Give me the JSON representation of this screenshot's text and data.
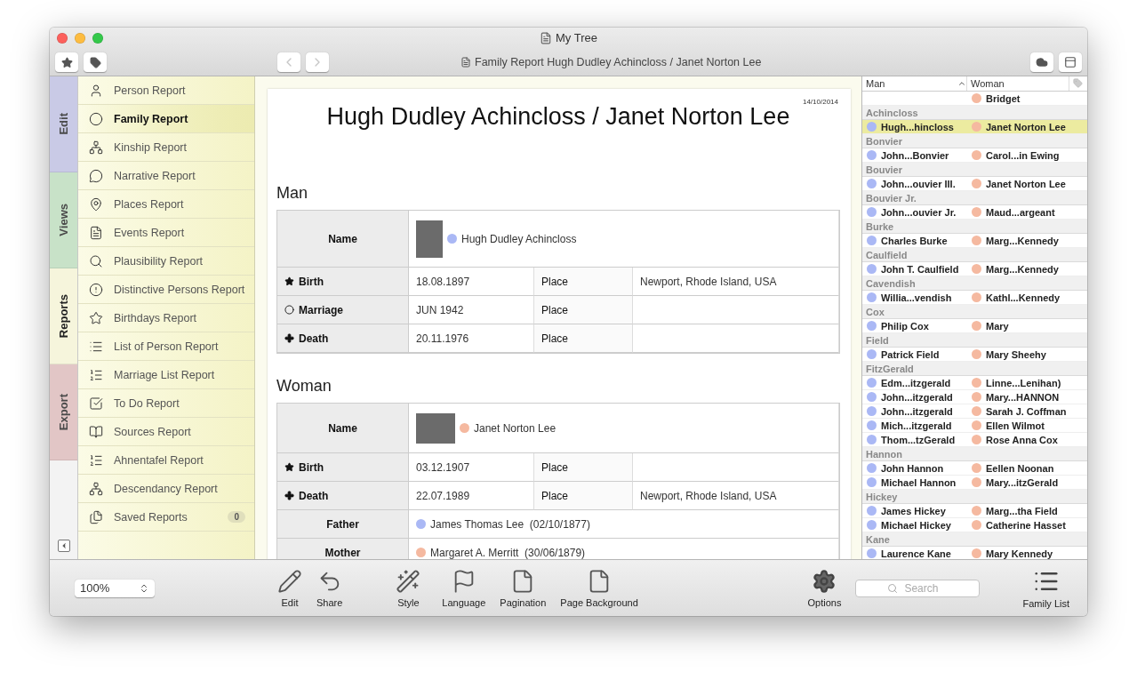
{
  "window": {
    "title": "My Tree"
  },
  "toolbar": {
    "document_title": "Family Report Hugh Dudley Achincloss / Janet Norton Lee"
  },
  "side_tabs": [
    {
      "label": "Edit",
      "selected": false,
      "color": "#c9cae6"
    },
    {
      "label": "Views",
      "selected": false,
      "color": "#c8e2c8"
    },
    {
      "label": "Reports",
      "selected": true,
      "color": "#f6f5dc"
    },
    {
      "label": "Export",
      "selected": false,
      "color": "#e2c6c6"
    }
  ],
  "reports": [
    {
      "label": "Person Report",
      "selected": false
    },
    {
      "label": "Family Report",
      "selected": true
    },
    {
      "label": "Kinship Report",
      "selected": false
    },
    {
      "label": "Narrative Report",
      "selected": false
    },
    {
      "label": "Places Report",
      "selected": false
    },
    {
      "label": "Events Report",
      "selected": false
    },
    {
      "label": "Plausibility Report",
      "selected": false
    },
    {
      "label": "Distinctive Persons Report",
      "selected": false
    },
    {
      "label": "Birthdays Report",
      "selected": false
    },
    {
      "label": "List of Person Report",
      "selected": false
    },
    {
      "label": "Marriage List Report",
      "selected": false
    },
    {
      "label": "To Do Report",
      "selected": false
    },
    {
      "label": "Sources Report",
      "selected": false
    },
    {
      "label": "Ahnentafel Report",
      "selected": false
    },
    {
      "label": "Descendancy Report",
      "selected": false
    },
    {
      "label": "Saved Reports",
      "selected": false,
      "count": "0"
    }
  ],
  "document": {
    "date": "14/10/2014",
    "title": "Hugh Dudley Achincloss / Janet Norton Lee",
    "sections": [
      {
        "heading": "Man",
        "rows": [
          {
            "kind": "name",
            "label": "Name",
            "person": "Hugh Dudley Achincloss",
            "color": "#aab8f5"
          },
          {
            "kind": "birth",
            "label": "Birth",
            "date": "18.08.1897",
            "place_label": "Place",
            "place": "Newport, Rhode Island, USA"
          },
          {
            "kind": "marriage",
            "label": "Marriage",
            "date": "JUN 1942",
            "place_label": "Place"
          },
          {
            "kind": "death",
            "label": "Death",
            "date": "20.11.1976",
            "place_label": "Place"
          }
        ]
      },
      {
        "heading": "Woman",
        "rows": [
          {
            "kind": "name",
            "label": "Name",
            "person": "Janet Norton Lee",
            "color": "#f5b9a0"
          },
          {
            "kind": "birth",
            "label": "Birth",
            "date": "03.12.1907",
            "place_label": "Place"
          },
          {
            "kind": "death",
            "label": "Death",
            "date": "22.07.1989",
            "place_label": "Place",
            "place": "Newport, Rhode Island, USA"
          },
          {
            "kind": "parent",
            "label": "Father",
            "person": "James Thomas Lee",
            "date": "(02/10/1877)",
            "color": "#aab8f5"
          },
          {
            "kind": "parent",
            "label": "Mother",
            "person": "Margaret A. Merritt",
            "date": "(30/06/1879)",
            "color": "#f5b9a0"
          }
        ]
      }
    ]
  },
  "family_list": {
    "columns": [
      "Man",
      "Woman"
    ],
    "rows": [
      {
        "kind": "couple",
        "woman": "Bridget",
        "selected": false
      },
      {
        "kind": "header",
        "surname": "Achincloss"
      },
      {
        "kind": "couple",
        "man": "Hugh...hincloss",
        "woman": "Janet Norton Lee",
        "selected": true
      },
      {
        "kind": "header",
        "surname": "Bonvier"
      },
      {
        "kind": "couple",
        "man": "John...Bonvier",
        "woman": "Carol...in Ewing",
        "selected": false
      },
      {
        "kind": "header",
        "surname": "Bouvier"
      },
      {
        "kind": "couple",
        "man": "John...ouvier III.",
        "woman": "Janet Norton Lee",
        "selected": false
      },
      {
        "kind": "header",
        "surname": "Bouvier Jr."
      },
      {
        "kind": "couple",
        "man": "John...ouvier Jr.",
        "woman": "Maud...argeant",
        "selected": false
      },
      {
        "kind": "header",
        "surname": "Burke"
      },
      {
        "kind": "couple",
        "man": "Charles Burke",
        "woman": "Marg...Kennedy",
        "selected": false
      },
      {
        "kind": "header",
        "surname": "Caulfield"
      },
      {
        "kind": "couple",
        "man": "John T. Caulfield",
        "woman": "Marg...Kennedy",
        "selected": false
      },
      {
        "kind": "header",
        "surname": "Cavendish"
      },
      {
        "kind": "couple",
        "man": "Willia...vendish",
        "woman": "Kathl...Kennedy",
        "selected": false
      },
      {
        "kind": "header",
        "surname": "Cox"
      },
      {
        "kind": "couple",
        "man": "Philip Cox",
        "woman": "Mary",
        "selected": false
      },
      {
        "kind": "header",
        "surname": "Field"
      },
      {
        "kind": "couple",
        "man": "Patrick Field",
        "woman": "Mary Sheehy",
        "selected": false
      },
      {
        "kind": "header",
        "surname": "FitzGerald"
      },
      {
        "kind": "couple",
        "man": "Edm...itzgerald",
        "woman": "Linne...Lenihan)",
        "selected": false
      },
      {
        "kind": "couple",
        "man": "John...itzgerald",
        "woman": "Mary...HANNON",
        "selected": false
      },
      {
        "kind": "couple",
        "man": "John...itzgerald",
        "woman": "Sarah J. Coffman",
        "selected": false
      },
      {
        "kind": "couple",
        "man": "Mich...itzgerald",
        "woman": "Ellen Wilmot",
        "selected": false
      },
      {
        "kind": "couple",
        "man": "Thom...tzGerald",
        "woman": "Rose Anna Cox",
        "selected": false
      },
      {
        "kind": "header",
        "surname": "Hannon"
      },
      {
        "kind": "couple",
        "man": "John Hannon",
        "woman": "Eellen Noonan",
        "selected": false
      },
      {
        "kind": "couple",
        "man": "Michael Hannon",
        "woman": "Mary...itzGerald",
        "selected": false
      },
      {
        "kind": "header",
        "surname": "Hickey"
      },
      {
        "kind": "couple",
        "man": "James Hickey",
        "woman": "Marg...tha Field",
        "selected": false
      },
      {
        "kind": "couple",
        "man": "Michael Hickey",
        "woman": "Catherine Hasset",
        "selected": false
      },
      {
        "kind": "header",
        "surname": "Kane"
      },
      {
        "kind": "couple",
        "man": "Laurence Kane",
        "woman": "Mary Kennedy",
        "selected": false
      }
    ]
  },
  "bottom_bar": {
    "zoom": "100%",
    "tools": [
      {
        "kind": "edit",
        "label": "Edit"
      },
      {
        "kind": "share",
        "label": "Share"
      },
      {
        "kind": "style",
        "label": "Style"
      },
      {
        "kind": "language",
        "label": "Language"
      },
      {
        "kind": "pagination",
        "label": "Pagination"
      },
      {
        "kind": "background",
        "label": "Page Background"
      }
    ],
    "options": "Options",
    "search_placeholder": "Search",
    "family_list": "Family List"
  }
}
